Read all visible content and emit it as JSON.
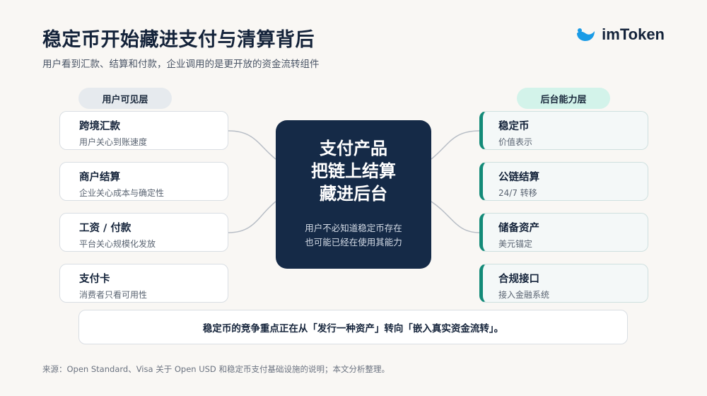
{
  "header": {
    "title": "稳定币开始藏进支付与清算背后",
    "subtitle": "用户看到汇款、结算和付款，企业调用的是更开放的资金流转组件"
  },
  "brand": {
    "name": "imToken",
    "color": "#1a9be6"
  },
  "layers": {
    "left_label": "用户可见层",
    "right_label": "后台能力层"
  },
  "left_cards": [
    {
      "title": "跨境汇款",
      "desc": "用户关心到账速度"
    },
    {
      "title": "商户结算",
      "desc": "企业关心成本与确定性"
    },
    {
      "title": "工资 / 付款",
      "desc": "平台关心规模化发放"
    },
    {
      "title": "支付卡",
      "desc": "消费者只看可用性"
    }
  ],
  "right_cards": [
    {
      "title": "稳定币",
      "desc": "价值表示"
    },
    {
      "title": "公链结算",
      "desc": "24/7 转移"
    },
    {
      "title": "储备资产",
      "desc": "美元锚定"
    },
    {
      "title": "合规接口",
      "desc": "接入金融系统"
    }
  ],
  "center": {
    "line1": "支付产品",
    "line2": "把链上结算",
    "line3": "藏进后台",
    "note1": "用户不必知道稳定币存在",
    "note2": "也可能已经在使用其能力"
  },
  "conclusion": "稳定币的竞争重点正在从「发行一种资产」转向「嵌入真实资金流转」。",
  "source": "来源：Open Standard、Visa 关于 Open USD 和稳定币支付基础设施的说明；本文分析整理。",
  "colors": {
    "navy": "#152a47",
    "teal": "#128a78",
    "background": "#f9f7f4"
  }
}
